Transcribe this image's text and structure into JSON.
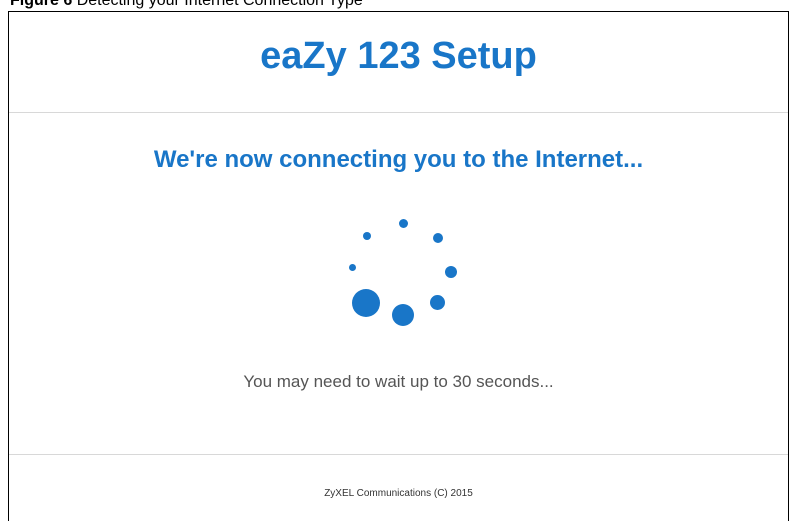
{
  "caption": {
    "label": "Figure 6",
    "text": "Detecting your Internet Connection Type"
  },
  "header": {
    "title": "eaZy 123 Setup"
  },
  "main": {
    "heading": "We're now connecting you to the Internet...",
    "wait_message": "You may need to wait up to 30 seconds...",
    "spinner_icon": "loading-spinner-icon"
  },
  "footer": {
    "copyright": "ZyXEL Communications (C) 2015"
  },
  "colors": {
    "accent": "#1976c8",
    "text_muted": "#555555"
  }
}
